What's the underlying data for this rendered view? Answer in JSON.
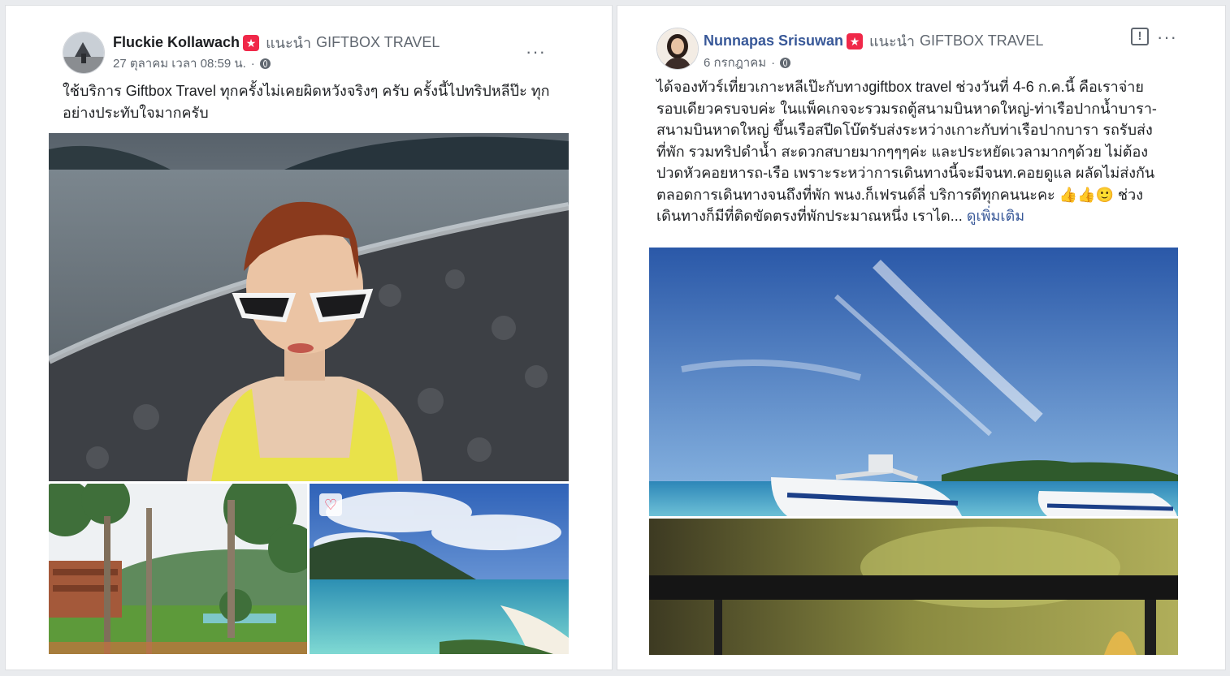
{
  "posts": [
    {
      "author": "Fluckie Kollawach",
      "recommend_text": "แนะนำ",
      "page_name": "GIFTBOX TRAVEL",
      "timestamp": "27 ตุลาคม เวลา 08:59 น.",
      "text": "ใช้บริการ Giftbox Travel ทุกครั้งไม่เคยผิดหวังจริงๆ ครับ ครั้งนี้ไปทริปหลีป๊ะ ทุกอย่างประทับใจมากครับ",
      "more_icon": "···"
    },
    {
      "author": "Nunnapas Srisuwan",
      "recommend_text": "แนะนำ",
      "page_name": "GIFTBOX TRAVEL",
      "timestamp": "6 กรกฎาคม",
      "text": "ได้จองทัวร์เที่ยวเกาะหลีเป๊ะกับทางgiftbox travel ช่วงวันที่ 4-6 ก.ค.นี้ คือเราจ่ายรอบเดียวครบจบค่ะ ในแพ็คเกจจะรวมรถตู้สนามบินหาดใหญ่-ท่าเรือปากน้ำบารา-สนามบินหาดใหญ่ ขึ้นเรือสปีดโบ๊ตรับส่งระหว่างเกาะกับท่าเรือปากบารา รถรับส่งที่พัก รวมทริปดำน้ำ สะดวกสบายมากๆๆๆค่ะ และประหยัดเวลามากๆด้วย ไม่ต้องปวดหัวคอยหารถ-เรือ เพราะระหว่าการเดินทางนี้จะมีจนท.คอยดูแล ผลัดไม่ส่งกันตลอดการเดินทางจนถึงที่พัก พนง.ก็เฟรนด์ลี่ บริการดีทุกคนนะคะ 👍👍🙂 ช่วงเดินทางก็มีที่ติดขัดตรงที่พักประมาณหนึ่ง เราได...",
      "see_more": "ดูเพิ่มเติม",
      "more_icon": "···",
      "report_icon": "!"
    }
  ],
  "icons": {
    "recommend": "recommend-star-icon",
    "privacy": "globe-icon",
    "heart": "♡"
  },
  "colors": {
    "recommend": "#f02849",
    "link": "#385898",
    "muted": "#606770",
    "background": "#e9ebee"
  }
}
